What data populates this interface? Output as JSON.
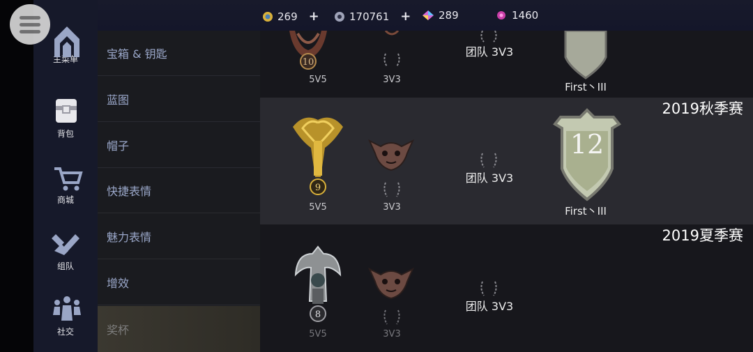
{
  "top_bar": {
    "gold": "269",
    "silver": "170761",
    "gems": "289",
    "essence": "1460",
    "plus": "+"
  },
  "sidebar": {
    "items": [
      {
        "label": "主菜单"
      },
      {
        "label": "背包"
      },
      {
        "label": "商城"
      },
      {
        "label": "组队"
      },
      {
        "label": "社交"
      }
    ]
  },
  "menu": {
    "items": [
      {
        "label": "宝箱 & 钥匙"
      },
      {
        "label": "蓝图"
      },
      {
        "label": "帽子"
      },
      {
        "label": "快捷表情"
      },
      {
        "label": "魅力表情"
      },
      {
        "label": "增效"
      },
      {
        "label": "奖杯"
      }
    ],
    "active_index": 6
  },
  "rows": [
    {
      "season": "",
      "mode_5v5": "5V5",
      "badge_5v5": "10",
      "mode_3v3": "3V3",
      "team": "团队 3V3",
      "rank": "First丶III"
    },
    {
      "season": "2019秋季赛",
      "mode_5v5": "5V5",
      "badge_5v5": "9",
      "mode_3v3": "3V3",
      "team": "团队 3V3",
      "rank": "First丶III",
      "shield_number": "12"
    },
    {
      "season": "2019夏季赛",
      "mode_5v5": "5V5",
      "badge_5v5": "8",
      "mode_3v3": "3V3",
      "team": "团队 3V3"
    }
  ],
  "colors": {
    "accent_gold": "#d9b13a",
    "menu_text": "#9aa7c9",
    "rail_bg": "#16192a"
  }
}
